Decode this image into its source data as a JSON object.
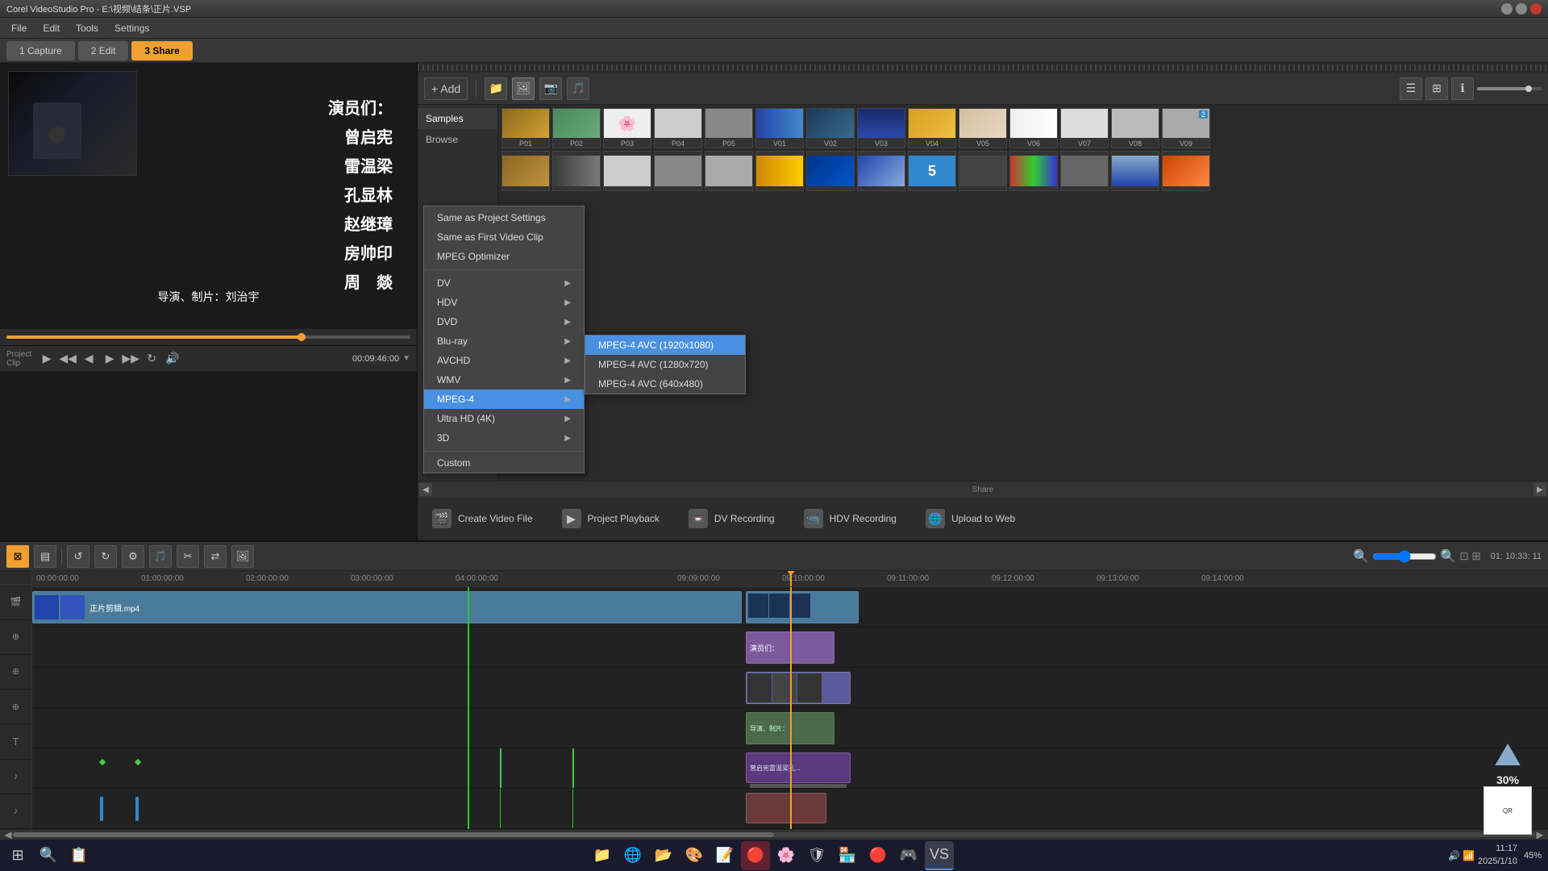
{
  "titlebar": {
    "title": "Corel VideoStudio Pro - E:\\视频\\结条\\正片.VSP",
    "close": "✕",
    "min": "─",
    "max": "□"
  },
  "menubar": {
    "items": [
      "File",
      "Edit",
      "Tools",
      "Settings"
    ]
  },
  "tabs": [
    {
      "label": "1  Capture",
      "active": false
    },
    {
      "label": "2  Edit",
      "active": false
    },
    {
      "label": "3  Share",
      "active": true
    }
  ],
  "preview": {
    "cast_label": "演员们：",
    "cast_names": [
      "曾启宪",
      "雷温梁",
      "孔显林",
      "赵继璋",
      "房帅印",
      "周  燚"
    ],
    "director_label": "导演、制片：刘治宇"
  },
  "playback": {
    "project_label": "Project",
    "clip_label": "Clip",
    "time": "00:09:46:00"
  },
  "media": {
    "add_button": "+ Add",
    "sidebar_items": [
      "Samples"
    ],
    "top_row_thumbs": [
      "P01",
      "P02",
      "P03",
      "P04",
      "P05",
      "V01",
      "V02",
      "V03",
      "V04",
      "V05",
      "V06",
      "V07",
      "V08",
      "V09"
    ],
    "bottom_row_thumbs": [
      "",
      "",
      "",
      "",
      "",
      "",
      "",
      "",
      "5",
      "",
      "",
      "",
      "",
      "",
      ""
    ]
  },
  "share": {
    "title": "Share",
    "options": [
      {
        "label": "Create Video File",
        "icon": "🎬"
      },
      {
        "label": "Project Playback",
        "icon": "▶"
      },
      {
        "label": "DV Recording",
        "icon": "📼"
      },
      {
        "label": "HDV Recording",
        "icon": "📹"
      },
      {
        "label": "Upload to Web",
        "icon": "🌐"
      }
    ]
  },
  "create_video_menu": {
    "items": [
      {
        "label": "Same as Project Settings",
        "has_arrow": false
      },
      {
        "label": "Same as First Video Clip",
        "has_arrow": false
      },
      {
        "label": "MPEG Optimizer",
        "has_arrow": false
      },
      {
        "label": "DV",
        "has_arrow": true
      },
      {
        "label": "HDV",
        "has_arrow": true
      },
      {
        "label": "DVD",
        "has_arrow": true
      },
      {
        "label": "Blu-ray",
        "has_arrow": true
      },
      {
        "label": "AVCHD",
        "has_arrow": true
      },
      {
        "label": "WMV",
        "has_arrow": true
      },
      {
        "label": "MPEG-4",
        "has_arrow": true,
        "highlighted": true
      },
      {
        "label": "Ultra HD (4K)",
        "has_arrow": true
      },
      {
        "label": "3D",
        "has_arrow": true
      },
      {
        "label": "Custom",
        "has_arrow": false
      }
    ]
  },
  "mpeg4_submenu": {
    "items": [
      {
        "label": "MPEG-4 AVC (1920x1080)",
        "highlighted": true
      },
      {
        "label": "MPEG-4 AVC (1280x720)"
      },
      {
        "label": "MPEG-4 AVC (640x480)"
      }
    ]
  },
  "timeline": {
    "toolbar_buttons": [
      "⊠",
      "▤",
      "↺",
      "↻",
      "⚙",
      "🎵",
      "✂",
      "🔀",
      "🖼"
    ],
    "time_display": "01: 10:33: 11",
    "ruler_marks": [
      "00:00:00:00",
      "01:00:00:00",
      "02:00:00:00",
      "03:00:00:00",
      "04:00:00:00",
      "09:09:00:00",
      "09:10:00:00",
      "09:11:00:00",
      "09:12:00:00",
      "09:13:00:00",
      "09:14:00:00"
    ],
    "tracks": [
      {
        "type": "video",
        "icon": "🎬"
      },
      {
        "type": "overlay",
        "icon": "⊕"
      },
      {
        "type": "overlay2",
        "icon": "⊕"
      },
      {
        "type": "overlay3",
        "icon": "⊕"
      },
      {
        "type": "title",
        "icon": "T"
      },
      {
        "type": "audio",
        "icon": "♪"
      },
      {
        "type": "audio2",
        "icon": "♪"
      }
    ],
    "main_clip": "正片剪辑.mp4"
  },
  "corner_widget": {
    "percent": "30%"
  },
  "taskbar": {
    "icons": [
      "⊞",
      "🔍",
      "📂",
      "💬",
      "🌐",
      "📁",
      "🎨",
      "📝",
      "🔴",
      "🌸",
      "🛡",
      "🏪",
      "🔴",
      "🎮"
    ],
    "time": "11:17",
    "date": "2025/1/10",
    "sys_icons": [
      "🔊",
      "📶",
      "🔋"
    ]
  }
}
